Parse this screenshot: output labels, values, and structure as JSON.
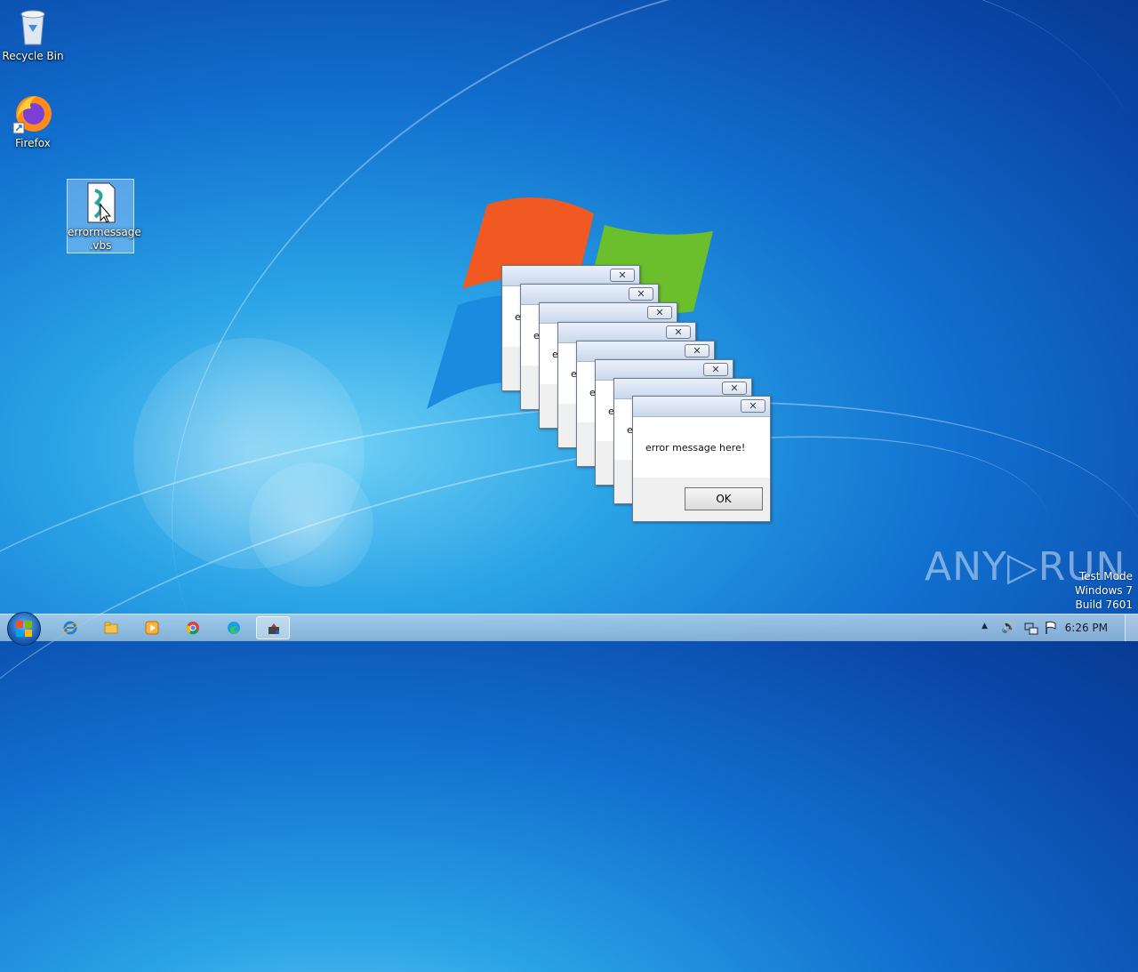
{
  "desktop": {
    "icons": [
      {
        "label": "Recycle Bin",
        "icon": "recycle-bin-icon"
      },
      {
        "label": "Firefox",
        "icon": "firefox-icon"
      },
      {
        "label": "errormessage\n.vbs",
        "icon": "vbs-script-icon",
        "selected": true
      }
    ]
  },
  "dialog": {
    "message": "error message here!",
    "message_partial": "e",
    "ok_label": "OK",
    "close_glyph": "✕"
  },
  "watermark": {
    "test_mode": "Test Mode",
    "os": "Windows 7",
    "build": "Build 7601",
    "brand": "ANY▷RUN"
  },
  "taskbar": {
    "pinned": [
      {
        "icon": "internet-explorer-icon"
      },
      {
        "icon": "file-explorer-icon"
      },
      {
        "icon": "media-player-icon"
      },
      {
        "icon": "chrome-icon"
      },
      {
        "icon": "edge-icon"
      },
      {
        "icon": "script-host-icon",
        "active": true
      }
    ],
    "clock": "6:26 PM"
  },
  "colors": {
    "desktop_blue": "#1170cf",
    "titlebar": "#c9d8ec",
    "dialog_body": "#f0f0f0"
  }
}
